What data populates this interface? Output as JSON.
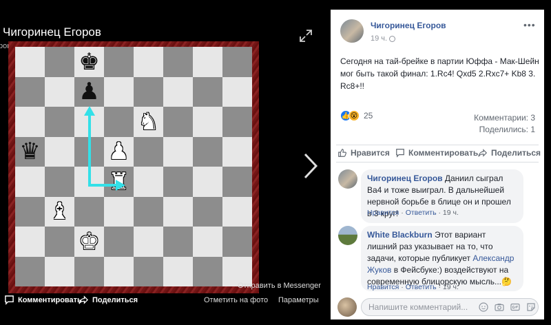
{
  "viewer": {
    "title": "Чигоринец Егоров",
    "subtitle": "роники",
    "messenger_link": "Отправить в Messenger",
    "comment_button": "Комментировать",
    "share_button": "Поделиться",
    "tag_photo": "Отметить на фото",
    "options": "Параметры"
  },
  "board": {
    "rows": [
      [
        "",
        "",
        "bK",
        "",
        "",
        "",
        "",
        ""
      ],
      [
        "",
        "",
        "bP",
        "",
        "",
        "",
        "",
        ""
      ],
      [
        "",
        "",
        "",
        "",
        "wN",
        "",
        "",
        ""
      ],
      [
        "bQ",
        "",
        "",
        "wP",
        "",
        "",
        "",
        ""
      ],
      [
        "",
        "",
        "",
        "wR",
        "",
        "",
        "",
        ""
      ],
      [
        "",
        "wB",
        "",
        "",
        "",
        "",
        "",
        ""
      ],
      [
        "",
        "",
        "wK",
        "",
        "",
        "",
        "",
        ""
      ],
      [
        "",
        "",
        "",
        "",
        "",
        "",
        "",
        ""
      ]
    ],
    "arrow_color": "#33e0e8",
    "light_square": "#e7e7e7",
    "dark_square": "#8d8d8d"
  },
  "post": {
    "author": "Чигоринец Егоров",
    "time": "19 ч.",
    "more": "•••",
    "text": "Сегодня на тай-брейке в партии Юффа - Мак-Шейн мог быть такой финал: 1.Rc4! Qxd5 2.Rxc7+ Kb8 3. Rc8+!!",
    "reactions_count": "25",
    "comments_count": "Комментарии: 3",
    "shares_count": "Поделились: 1",
    "actions": {
      "like": "Нравится",
      "comment": "Комментировать",
      "share": "Поделиться"
    }
  },
  "comments": [
    {
      "author": "Чигоринец Егоров",
      "text": " Даниил сыграл Ва4 и тоже выиграл. В дальнейшей нервной борьбе в блице он и прошел в 3 круг!",
      "like": "Нравится",
      "reply": "Ответить",
      "time": "19 ч."
    },
    {
      "author": "White Blackburn",
      "text_before": " Этот вариант лишний раз указывает на то, что задачи, которые публикует ",
      "mention": "Александр Жуков",
      "text_after": " в Фейсбуке:) воздействуют на современную блицорскую мысль...",
      "emoji": "🤔",
      "like": "Нравится",
      "reply": "Ответить",
      "time": "19 ч."
    }
  ],
  "compose": {
    "placeholder": "Напишите комментарий..."
  }
}
